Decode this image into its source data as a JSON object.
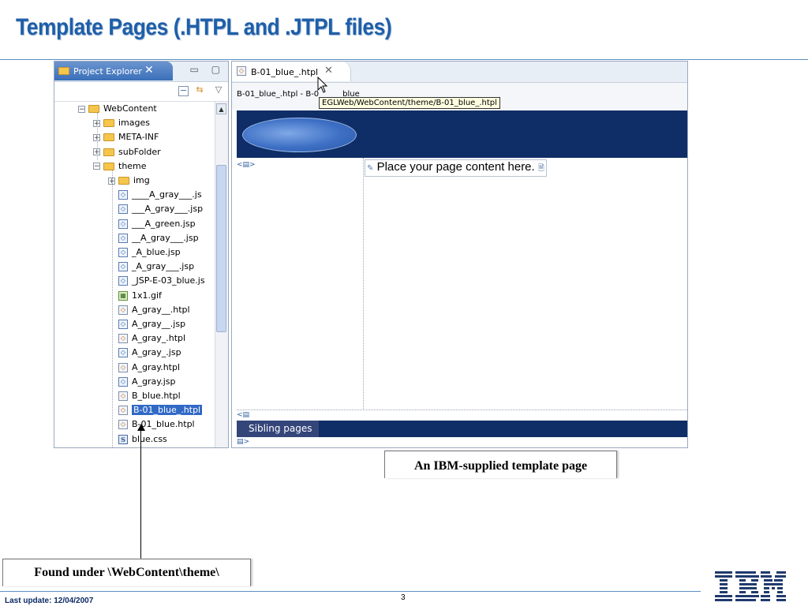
{
  "slide": {
    "title": "Template Pages (.HTPL and .JTPL files)",
    "footer_date": "Last update: 12/04/2007",
    "page_number": "3",
    "logo_text": "IBM"
  },
  "project_explorer": {
    "tab_label": "Project Explorer",
    "tab_close": "✕",
    "window_buttons": "▭ ▢",
    "toolbar_icons": [
      "collapse-all-icon",
      "link-with-editor-icon",
      "view-menu-icon"
    ],
    "tree": [
      {
        "label": "WebContent",
        "depth": 0,
        "type": "folder",
        "expanded": true
      },
      {
        "label": "images",
        "depth": 1,
        "type": "folder",
        "expanded": false
      },
      {
        "label": "META-INF",
        "depth": 1,
        "type": "folder",
        "expanded": false
      },
      {
        "label": "subFolder",
        "depth": 1,
        "type": "folder",
        "expanded": false
      },
      {
        "label": "theme",
        "depth": 1,
        "type": "folder",
        "expanded": true
      },
      {
        "label": "img",
        "depth": 2,
        "type": "folder",
        "expanded": false
      },
      {
        "label": "____A_gray___.js",
        "depth": 2,
        "type": "jsp"
      },
      {
        "label": "___A_gray___.jsp",
        "depth": 2,
        "type": "jsp"
      },
      {
        "label": "___A_green.jsp",
        "depth": 2,
        "type": "jsp"
      },
      {
        "label": "__A_gray___.jsp",
        "depth": 2,
        "type": "jsp"
      },
      {
        "label": "_A_blue.jsp",
        "depth": 2,
        "type": "jsp"
      },
      {
        "label": "_A_gray___.jsp",
        "depth": 2,
        "type": "jsp"
      },
      {
        "label": "_JSP-E-03_blue.js",
        "depth": 2,
        "type": "jsp"
      },
      {
        "label": "1x1.gif",
        "depth": 2,
        "type": "gif"
      },
      {
        "label": "A_gray__.htpl",
        "depth": 2,
        "type": "htpl"
      },
      {
        "label": "A_gray__.jsp",
        "depth": 2,
        "type": "jsp"
      },
      {
        "label": "A_gray_.htpl",
        "depth": 2,
        "type": "htpl"
      },
      {
        "label": "A_gray_.jsp",
        "depth": 2,
        "type": "jsp"
      },
      {
        "label": "A_gray.htpl",
        "depth": 2,
        "type": "htpl"
      },
      {
        "label": "A_gray.jsp",
        "depth": 2,
        "type": "jsp"
      },
      {
        "label": "B_blue.htpl",
        "depth": 2,
        "type": "htpl"
      },
      {
        "label": "B-01_blue_.htpl",
        "depth": 2,
        "type": "htpl",
        "selected": true
      },
      {
        "label": "B-01_blue.htpl",
        "depth": 2,
        "type": "htpl"
      },
      {
        "label": "blue.css",
        "depth": 2,
        "type": "css"
      }
    ]
  },
  "editor": {
    "tab_label": "B-01_blue_.htpl",
    "tab_close": "✕",
    "subtitle": "B-01_blue_.htpl - B-0",
    "subtitle_suffix": "blue",
    "tooltip": "EGLWeb/WebContent/theme/B-01_blue_.htpl",
    "content_placeholder": "Place your page content here.",
    "sibling_label": "Sibling pages"
  },
  "callouts": {
    "template_note": "An IBM-supplied template page",
    "location_note": "Found under \\WebContent\\theme\\"
  },
  "colors": {
    "title": "#1f5fa8",
    "banner": "#0f2d66",
    "selection": "#3169c6"
  }
}
